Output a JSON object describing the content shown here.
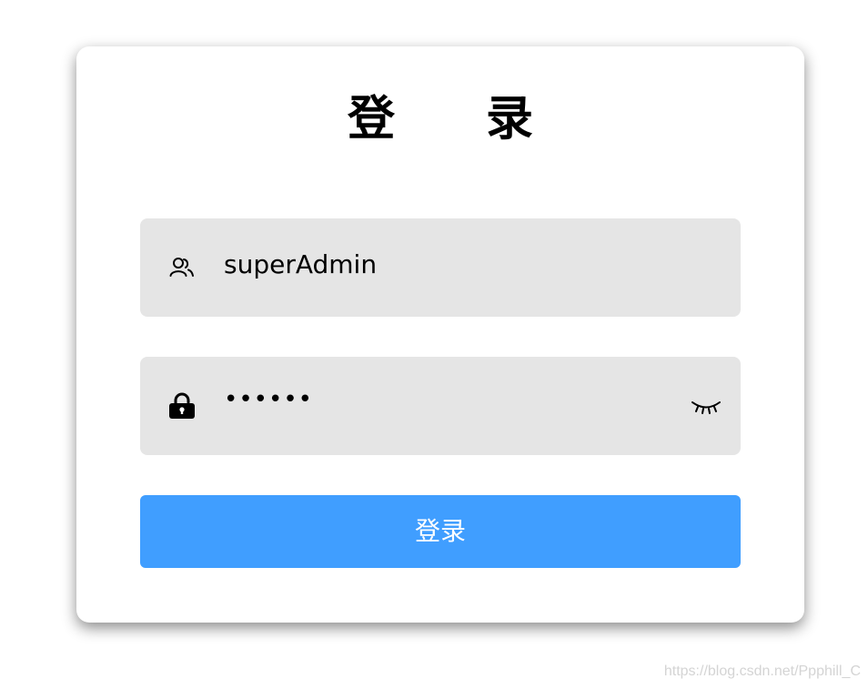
{
  "login": {
    "title": "登录",
    "username": {
      "icon": "user-icon",
      "value": "superAdmin"
    },
    "password": {
      "icon": "lock-icon",
      "masked_value": "••••••",
      "toggle_icon": "eye-closed-icon"
    },
    "submit_label": "登录"
  },
  "colors": {
    "button": "#409eff",
    "field_background": "#e5e5e5"
  },
  "watermark": "https://blog.csdn.net/Ppphill_C"
}
